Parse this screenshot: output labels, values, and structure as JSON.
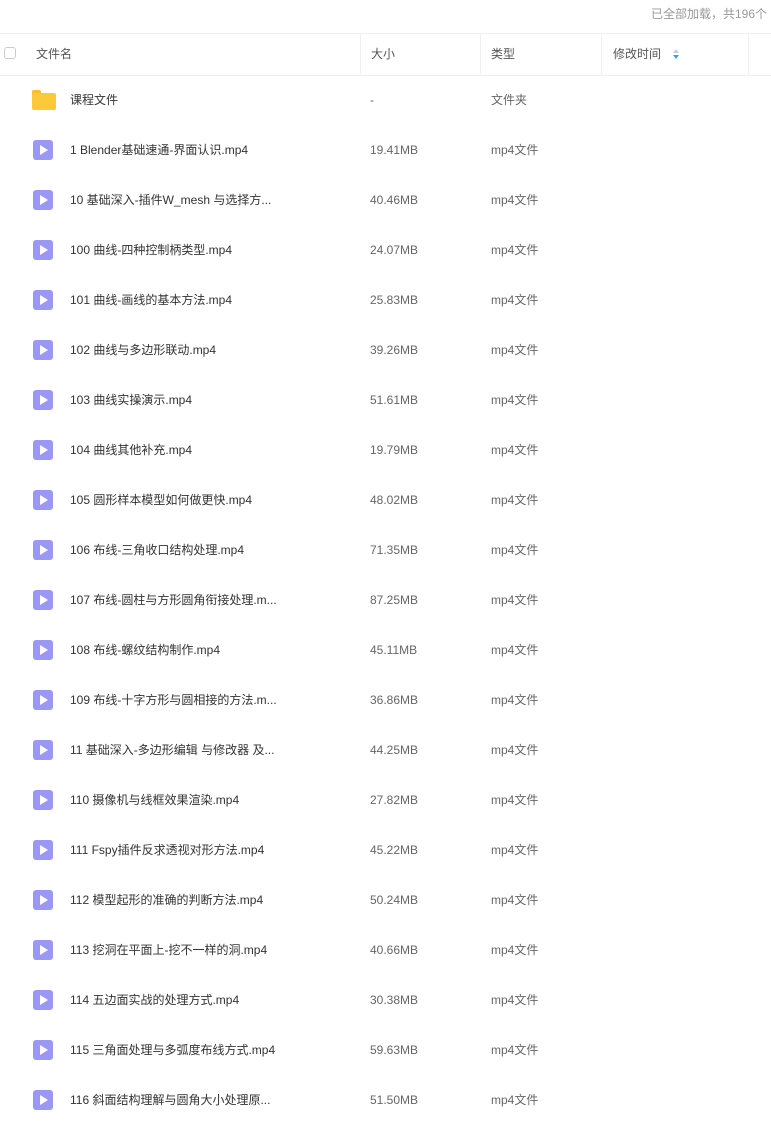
{
  "status": {
    "loaded_text": "已全部加载，共196个"
  },
  "columns": {
    "name": "文件名",
    "size": "大小",
    "type": "类型",
    "modified": "修改时间"
  },
  "colors": {
    "folder": "#fcc93b",
    "video": "#9b97f5",
    "sort_arrow": "#2aa7ff"
  },
  "files": [
    {
      "name": "课程文件",
      "size": "-",
      "type": "文件夹",
      "icon": "folder-icon"
    },
    {
      "name": "1 Blender基础速通-界面认识.mp4",
      "size": "19.41MB",
      "type": "mp4文件",
      "icon": "video-icon"
    },
    {
      "name": "10 基础深入-插件W_mesh 与选择方...",
      "size": "40.46MB",
      "type": "mp4文件",
      "icon": "video-icon"
    },
    {
      "name": "100 曲线-四种控制柄类型.mp4",
      "size": "24.07MB",
      "type": "mp4文件",
      "icon": "video-icon"
    },
    {
      "name": "101 曲线-画线的基本方法.mp4",
      "size": "25.83MB",
      "type": "mp4文件",
      "icon": "video-icon"
    },
    {
      "name": "102 曲线与多边形联动.mp4",
      "size": "39.26MB",
      "type": "mp4文件",
      "icon": "video-icon"
    },
    {
      "name": "103 曲线实操演示.mp4",
      "size": "51.61MB",
      "type": "mp4文件",
      "icon": "video-icon"
    },
    {
      "name": "104 曲线其他补充.mp4",
      "size": "19.79MB",
      "type": "mp4文件",
      "icon": "video-icon"
    },
    {
      "name": "105 圆形样本模型如何做更快.mp4",
      "size": "48.02MB",
      "type": "mp4文件",
      "icon": "video-icon"
    },
    {
      "name": "106 布线-三角收口结构处理.mp4",
      "size": "71.35MB",
      "type": "mp4文件",
      "icon": "video-icon"
    },
    {
      "name": "107 布线-圆柱与方形圆角衔接处理.m...",
      "size": "87.25MB",
      "type": "mp4文件",
      "icon": "video-icon"
    },
    {
      "name": "108 布线-螺纹结构制作.mp4",
      "size": "45.11MB",
      "type": "mp4文件",
      "icon": "video-icon"
    },
    {
      "name": "109 布线-十字方形与圆相接的方法.m...",
      "size": "36.86MB",
      "type": "mp4文件",
      "icon": "video-icon"
    },
    {
      "name": "11 基础深入-多边形编辑 与修改器 及...",
      "size": "44.25MB",
      "type": "mp4文件",
      "icon": "video-icon"
    },
    {
      "name": "110 摄像机与线框效果渲染.mp4",
      "size": "27.82MB",
      "type": "mp4文件",
      "icon": "video-icon"
    },
    {
      "name": "111 Fspy插件反求透视对形方法.mp4",
      "size": "45.22MB",
      "type": "mp4文件",
      "icon": "video-icon"
    },
    {
      "name": "112 模型起形的准确的判断方法.mp4",
      "size": "50.24MB",
      "type": "mp4文件",
      "icon": "video-icon"
    },
    {
      "name": "113 挖洞在平面上-挖不一样的洞.mp4",
      "size": "40.66MB",
      "type": "mp4文件",
      "icon": "video-icon"
    },
    {
      "name": "114 五边面实战的处理方式.mp4",
      "size": "30.38MB",
      "type": "mp4文件",
      "icon": "video-icon"
    },
    {
      "name": "115 三角面处理与多弧度布线方式.mp4",
      "size": "59.63MB",
      "type": "mp4文件",
      "icon": "video-icon"
    },
    {
      "name": "116 斜面结构理解与圆角大小处理原...",
      "size": "51.50MB",
      "type": "mp4文件",
      "icon": "video-icon"
    }
  ]
}
